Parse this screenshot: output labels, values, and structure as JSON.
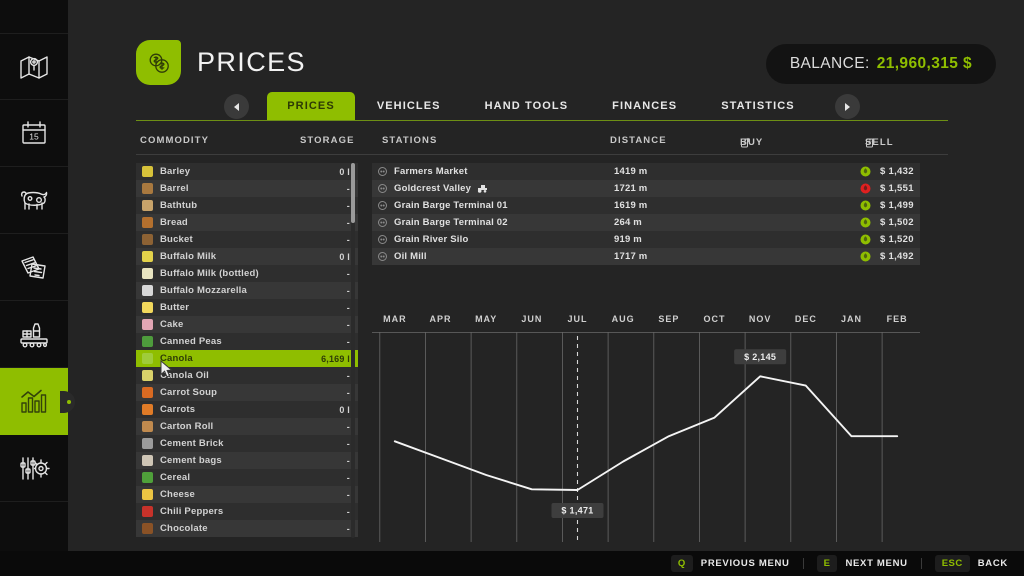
{
  "sidebar": {
    "items": [
      {
        "name": "map",
        "label": "Map"
      },
      {
        "name": "calendar",
        "label": "Calendar",
        "day": "15"
      },
      {
        "name": "animals",
        "label": "Animals"
      },
      {
        "name": "contracts",
        "label": "Contracts"
      },
      {
        "name": "production",
        "label": "Production"
      },
      {
        "name": "statistics",
        "label": "Statistics",
        "active": true
      },
      {
        "name": "settings",
        "label": "Settings"
      }
    ]
  },
  "header": {
    "title": "PRICES",
    "badge_icon": "coins-icon",
    "balance_label": "BALANCE:",
    "balance_value": "21,960,315 $",
    "balance_color": "#8fbe00"
  },
  "tabs": {
    "prev_arrow": "chevron-left-icon",
    "next_arrow": "chevron-right-icon",
    "items": [
      {
        "label": "PRICES",
        "active": true
      },
      {
        "label": "VEHICLES",
        "active": false
      },
      {
        "label": "HAND TOOLS",
        "active": false
      },
      {
        "label": "FINANCES",
        "active": false
      },
      {
        "label": "STATISTICS",
        "active": false
      }
    ]
  },
  "columns": {
    "commodity": "COMMODITY",
    "storage": "STORAGE",
    "stations": "STATIONS",
    "distance": "DISTANCE",
    "buy": "BUY",
    "sell": "SELL"
  },
  "commodities": [
    {
      "name": "Barley",
      "storage": "0 l",
      "color": "#d7c23a",
      "selected": false
    },
    {
      "name": "Barrel",
      "storage": "-",
      "color": "#a9793f",
      "selected": false
    },
    {
      "name": "Bathtub",
      "storage": "-",
      "color": "#c8a36a",
      "selected": false
    },
    {
      "name": "Bread",
      "storage": "-",
      "color": "#b4702e",
      "selected": false
    },
    {
      "name": "Bucket",
      "storage": "-",
      "color": "#8d6234",
      "selected": false
    },
    {
      "name": "Buffalo Milk",
      "storage": "0 l",
      "color": "#e3d24a",
      "selected": false
    },
    {
      "name": "Buffalo Milk (bottled)",
      "storage": "-",
      "color": "#e8e3c0",
      "selected": false
    },
    {
      "name": "Buffalo Mozzarella",
      "storage": "-",
      "color": "#d8d8d8",
      "selected": false
    },
    {
      "name": "Butter",
      "storage": "-",
      "color": "#f2d85c",
      "selected": false
    },
    {
      "name": "Cake",
      "storage": "-",
      "color": "#e2a6b4",
      "selected": false
    },
    {
      "name": "Canned Peas",
      "storage": "-",
      "color": "#4e9b3c",
      "selected": false
    },
    {
      "name": "Canola",
      "storage": "6,169 l",
      "color": "#9fcc3a",
      "selected": true
    },
    {
      "name": "Canola Oil",
      "storage": "-",
      "color": "#d9d16a",
      "selected": false
    },
    {
      "name": "Carrot Soup",
      "storage": "-",
      "color": "#d96a22",
      "selected": false
    },
    {
      "name": "Carrots",
      "storage": "0 l",
      "color": "#e07b27",
      "selected": false
    },
    {
      "name": "Carton Roll",
      "storage": "-",
      "color": "#c08a4e",
      "selected": false
    },
    {
      "name": "Cement Brick",
      "storage": "-",
      "color": "#9b9b9b",
      "selected": false
    },
    {
      "name": "Cement bags",
      "storage": "-",
      "color": "#cfc6b6",
      "selected": false
    },
    {
      "name": "Cereal",
      "storage": "-",
      "color": "#4fa03a",
      "selected": false
    },
    {
      "name": "Cheese",
      "storage": "-",
      "color": "#ecc543",
      "selected": false
    },
    {
      "name": "Chili Peppers",
      "storage": "-",
      "color": "#c7322a",
      "selected": false
    },
    {
      "name": "Chocolate",
      "storage": "-",
      "color": "#8a5226",
      "selected": false
    }
  ],
  "stations": [
    {
      "name": "Farmers Market",
      "distance": "1419 m",
      "price": "$ 1,432",
      "trend": "up",
      "dot_color": "#8fbe00",
      "extra_icon": null
    },
    {
      "name": "Goldcrest Valley",
      "distance": "1721 m",
      "price": "$ 1,551",
      "trend": "down",
      "dot_color": "#e02020",
      "extra_icon": "tractor-icon"
    },
    {
      "name": "Grain Barge Terminal 01",
      "distance": "1619 m",
      "price": "$ 1,499",
      "trend": "up",
      "dot_color": "#8fbe00",
      "extra_icon": null
    },
    {
      "name": "Grain Barge Terminal 02",
      "distance": "264 m",
      "price": "$ 1,502",
      "trend": "up",
      "dot_color": "#8fbe00",
      "extra_icon": null
    },
    {
      "name": "Grain River Silo",
      "distance": "919 m",
      "price": "$ 1,520",
      "trend": "up",
      "dot_color": "#8fbe00",
      "extra_icon": null
    },
    {
      "name": "Oil Mill",
      "distance": "1717 m",
      "price": "$ 1,492",
      "trend": "up",
      "dot_color": "#8fbe00",
      "extra_icon": null
    }
  ],
  "chart_data": {
    "type": "line",
    "title": "",
    "xlabel": "",
    "ylabel": "",
    "categories": [
      "MAR",
      "APR",
      "MAY",
      "JUN",
      "JUL",
      "AUG",
      "SEP",
      "OCT",
      "NOV",
      "DEC",
      "JAN",
      "FEB"
    ],
    "series": [
      {
        "name": "Canola price",
        "values": [
          1760,
          1660,
          1560,
          1475,
          1471,
          1640,
          1790,
          1900,
          2145,
          2090,
          1790,
          1790
        ]
      }
    ],
    "ylim": [
      1400,
      2200
    ],
    "grid": true,
    "legend": "none",
    "current_marker": {
      "month": "JUL",
      "label": "$ 1,471"
    },
    "peak_marker": {
      "month": "NOV",
      "label": "$ 2,145"
    },
    "annotations": [
      "$ 1,471",
      "$ 2,145"
    ]
  },
  "bottombar": {
    "hints": [
      {
        "key": "Q",
        "text": "PREVIOUS MENU"
      },
      {
        "key": "E",
        "text": "NEXT MENU"
      },
      {
        "key": "ESC",
        "text": "BACK"
      }
    ]
  }
}
